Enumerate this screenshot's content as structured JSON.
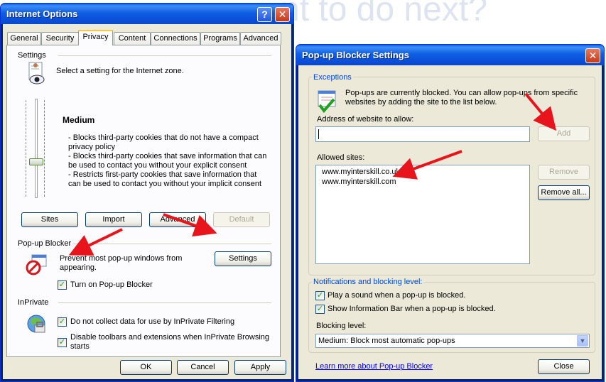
{
  "background_heading": "nt to do next?",
  "internet_options": {
    "title": "Internet Options",
    "tabs": [
      "General",
      "Security",
      "Privacy",
      "Content",
      "Connections",
      "Programs",
      "Advanced"
    ],
    "active_tab": "Privacy",
    "settings": {
      "heading": "Settings",
      "instruction": "Select a setting for the Internet zone.",
      "level": "Medium",
      "description": [
        "- Blocks third-party cookies that do not have a compact",
        "privacy policy",
        "- Blocks third-party cookies that save information that can",
        "be used to contact you without your explicit consent",
        "- Restricts first-party cookies that save information that",
        "can be used to contact you without your implicit consent"
      ],
      "buttons": {
        "sites": "Sites",
        "import": "Import",
        "advanced": "Advanced",
        "default": "Default"
      }
    },
    "popup_blocker": {
      "heading": "Pop-up Blocker",
      "text_line1": "Prevent most pop-up windows from",
      "text_line2": "appearing.",
      "settings_button": "Settings",
      "checkbox_label": "Turn on Pop-up Blocker",
      "checked": true
    },
    "inprivate": {
      "heading": "InPrivate",
      "option1": "Do not collect data for use by InPrivate Filtering",
      "option2_line1": "Disable toolbars and extensions when InPrivate Browsing",
      "option2_line2": "starts",
      "option1_checked": true,
      "option2_checked": true
    },
    "footer": {
      "ok": "OK",
      "cancel": "Cancel",
      "apply": "Apply"
    }
  },
  "popup_settings": {
    "title": "Pop-up Blocker Settings",
    "exceptions": {
      "heading": "Exceptions",
      "info_line1": "Pop-ups are currently blocked.  You can allow pop-ups from specific",
      "info_line2": "websites by adding the site to the list below.",
      "address_label": "Address of website to allow:",
      "address_value": "",
      "add_button": "Add",
      "allowed_label": "Allowed sites:",
      "allowed_sites": [
        "www.myinterskill.co.uk",
        "www.myinterskill.com"
      ],
      "remove_button": "Remove",
      "remove_all_button": "Remove all..."
    },
    "notifications": {
      "heading": "Notifications and blocking level:",
      "play_sound": "Play a sound when a pop-up is blocked.",
      "info_bar": "Show Information Bar when a pop-up is blocked.",
      "play_sound_checked": true,
      "info_bar_checked": true,
      "blocking_label": "Blocking level:",
      "blocking_value": "Medium: Block most automatic pop-ups"
    },
    "learn_more": "Learn more about Pop-up Blocker",
    "close_button": "Close"
  },
  "colors": {
    "titlebar": "#0a4ed8",
    "dialog_bg": "#ece9d8",
    "annotation_arrow": "#e8141b",
    "group_heading": "#0046d5"
  }
}
